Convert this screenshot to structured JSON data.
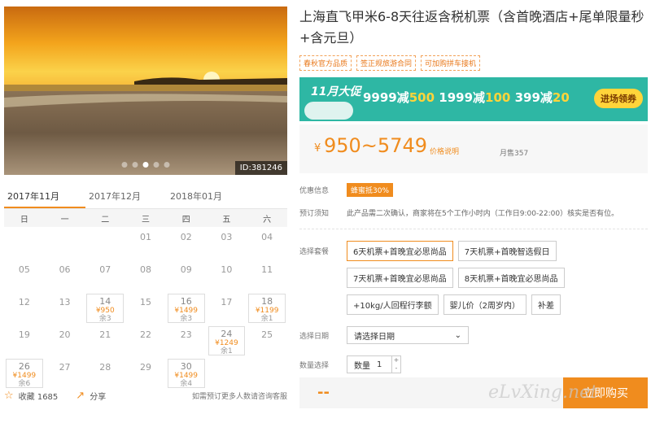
{
  "gallery": {
    "id_label": "ID:381246",
    "dot_count": 5,
    "active_dot": 2
  },
  "calendar": {
    "tabs": [
      {
        "label": "2017年11月",
        "active": true
      },
      {
        "label": "2017年12月",
        "active": false
      },
      {
        "label": "2018年01月",
        "active": false
      }
    ],
    "weekdays": [
      "日",
      "一",
      "二",
      "三",
      "四",
      "五",
      "六"
    ],
    "cells": [
      {
        "day": ""
      },
      {
        "day": ""
      },
      {
        "day": ""
      },
      {
        "day": "01"
      },
      {
        "day": "02"
      },
      {
        "day": "03"
      },
      {
        "day": "04"
      },
      {
        "day": "05"
      },
      {
        "day": "06"
      },
      {
        "day": "07"
      },
      {
        "day": "08"
      },
      {
        "day": "09"
      },
      {
        "day": "10"
      },
      {
        "day": "11"
      },
      {
        "day": "12"
      },
      {
        "day": "13"
      },
      {
        "day": "14",
        "price": "¥950",
        "stock": "余3"
      },
      {
        "day": "15"
      },
      {
        "day": "16",
        "price": "¥1499",
        "stock": "余3"
      },
      {
        "day": "17"
      },
      {
        "day": "18",
        "price": "¥1199",
        "stock": "余1"
      },
      {
        "day": "19"
      },
      {
        "day": "20"
      },
      {
        "day": "21"
      },
      {
        "day": "22"
      },
      {
        "day": "23"
      },
      {
        "day": "24",
        "price": "¥1249",
        "stock": "余1"
      },
      {
        "day": "25"
      },
      {
        "day": "26",
        "price": "¥1499",
        "stock": "余6"
      },
      {
        "day": "27"
      },
      {
        "day": "28"
      },
      {
        "day": "29"
      },
      {
        "day": "30",
        "price": "¥1499",
        "stock": "余4"
      }
    ]
  },
  "bottom": {
    "favorite": "收藏 1685",
    "share": "分享",
    "more": "如需预订更多人数请咨询客服"
  },
  "product": {
    "title": "上海直飞甲米6-8天往返含税机票（含首晚酒店+尾单限量秒+含元旦）",
    "badges": [
      "春秋官方品质",
      "签正规旅游合同",
      "可加购拼车接机"
    ]
  },
  "banner": {
    "tag": "11月大促",
    "deals": [
      {
        "a": "9999减",
        "b": "500"
      },
      {
        "a": "1999减",
        "b": "100"
      },
      {
        "a": "399减",
        "b": "20"
      }
    ],
    "button": "进场领券"
  },
  "price": {
    "currency": "¥",
    "range": "950~5749",
    "explain": "价格说明",
    "sold": "月售357"
  },
  "info": {
    "promo_label": "优惠信息",
    "promo_value": "蜂蜜抵30%",
    "notice_label": "预订须知",
    "notice_value": "此产品需二次确认，商家将在5个工作小时内（工作日9:00-22:00）核实是否有位。"
  },
  "packages": {
    "label": "选择套餐",
    "options": [
      {
        "label": "6天机票+首晚宜必思尚品",
        "selected": true
      },
      {
        "label": "7天机票+首晚智选假日",
        "selected": false
      },
      {
        "label": "7天机票+首晚宜必思尚品",
        "selected": false
      },
      {
        "label": "8天机票+首晚宜必思尚品",
        "selected": false
      },
      {
        "label": "+10kg/人回程行李额",
        "selected": false
      },
      {
        "label": "婴儿价（2周岁内）",
        "selected": false
      },
      {
        "label": "补差",
        "selected": false
      }
    ]
  },
  "date": {
    "label": "选择日期",
    "placeholder": "请选择日期"
  },
  "quantity": {
    "label": "数量选择",
    "field_label": "数量",
    "value": "1",
    "plus": "+",
    "minus": "-"
  },
  "buy": {
    "total": "--",
    "button": "立即购买"
  },
  "watermark": "eLvXing.net",
  "colors": {
    "accent": "#f08c1e",
    "banner": "#2eb7a4"
  }
}
